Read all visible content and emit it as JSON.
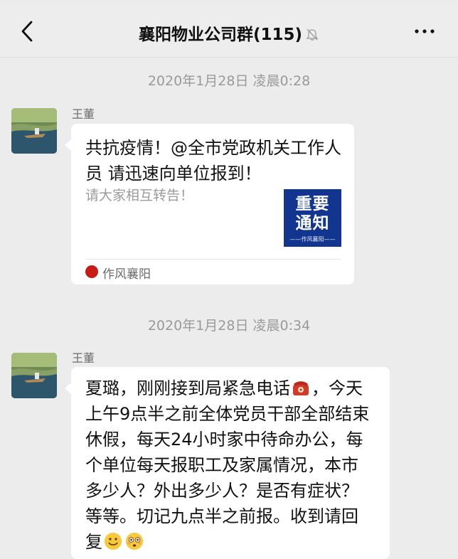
{
  "status_bar": {
    "carrier": "",
    "time": "",
    "battery": ""
  },
  "header": {
    "back_icon": "chevron-left-icon",
    "title": "襄阳物业公司群(115)",
    "mute_icon": "bell-off-icon",
    "more_icon": "more-horizontal-icon"
  },
  "messages": [
    {
      "timestamp": "2020年1月28日 凌晨0:28",
      "sender": "王董",
      "type": "article_card",
      "card": {
        "title": "共抗疫情！@全市党政机关工作人员 请迅速向单位报到！",
        "description": "请大家相互转告！",
        "thumbnail_text_1": "重要",
        "thumbnail_text_2": "通知",
        "thumbnail_caption": "——作风襄阳——",
        "source_name": "作风襄阳",
        "thumbnail_color": "#12358f"
      }
    },
    {
      "timestamp": "2020年1月28日 凌晨0:34",
      "sender": "王董",
      "type": "text",
      "text_part_1": "夏璐，刚刚接到局紧急电话",
      "text_part_2": "，今天上午9点半之前全体党员干部全部结束休假，每天24小时家中待命办公，每个单位每天报职工及家属情况，本市多少人？外出多少人？是否有症状？等等。切记九点半之前报。收到请回复",
      "emojis": [
        "telephone-icon",
        "smile-emoji",
        "flushed-emoji"
      ]
    }
  ],
  "colors": {
    "background": "#ececec",
    "bubble": "#ffffff",
    "timestamp": "#9a9a9a"
  }
}
